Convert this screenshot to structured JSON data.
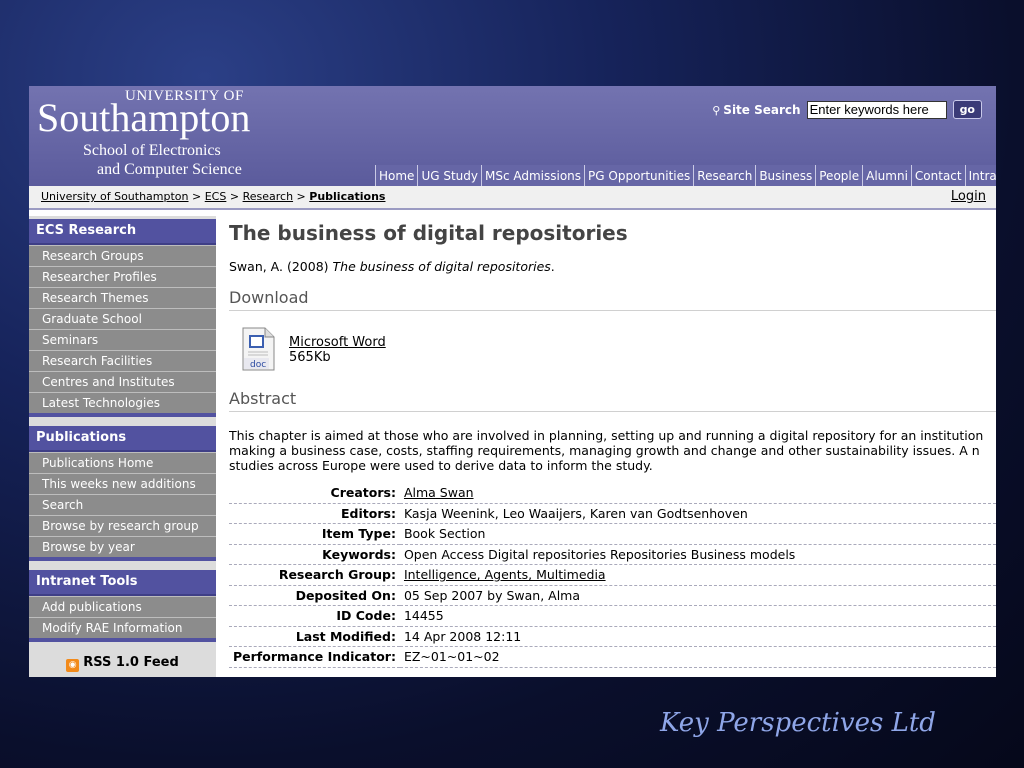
{
  "slide": {
    "footer_title": "Key Perspectives Ltd"
  },
  "header": {
    "logo_top": "UNIVERSITY OF",
    "logo_main": "Southampton",
    "logo_sub1": "School of Electronics",
    "logo_sub2": "and Computer Science",
    "search_label": "Site Search",
    "search_value": "Enter keywords here",
    "search_button": "go",
    "nav": [
      "Home",
      "UG Study",
      "MSc Admissions",
      "PG Opportunities",
      "Research",
      "Business",
      "People",
      "Alumni",
      "Contact",
      "Intranet"
    ]
  },
  "breadcrumb": {
    "items": [
      "University of Southampton",
      "ECS",
      "Research"
    ],
    "separator": ">",
    "current": "Publications",
    "login": "Login"
  },
  "sidebar": {
    "sections": [
      {
        "title": "ECS Research",
        "items": [
          "Research Groups",
          "Researcher Profiles",
          "Research Themes",
          "Graduate School",
          "Seminars",
          "Research Facilities",
          "Centres and Institutes",
          "Latest Technologies"
        ]
      },
      {
        "title": "Publications",
        "items": [
          "Publications Home",
          "This weeks new additions",
          "Search",
          "Browse by research group",
          "Browse by year"
        ]
      },
      {
        "title": "Intranet Tools",
        "items": [
          "Add publications",
          "Modify RAE Information"
        ]
      }
    ],
    "rss": "RSS 1.0 Feed"
  },
  "main": {
    "title": "The business of digital repositories",
    "citation_authors": "Swan, A. (2008)",
    "citation_title": "The business of digital repositories",
    "citation_end": ".",
    "download_heading": "Download",
    "download_icon_label": "doc",
    "download_link": "Microsoft Word",
    "download_size": "565Kb",
    "abstract_heading": "Abstract",
    "abstract_line1": "This chapter is aimed at those who are involved in planning, setting up and running a digital repository for an institution",
    "abstract_line2": "making a business case, costs, staffing requirements, managing growth and change and other sustainability issues. A n",
    "abstract_line3": "studies across Europe were used to derive data to inform the study.",
    "metadata": [
      {
        "label": "Creators:",
        "value": "Alma Swan",
        "link": true
      },
      {
        "label": "Editors:",
        "value": "Kasja Weenink, Leo Waaijers, Karen van Godtsenhoven",
        "link": false
      },
      {
        "label": "Item Type:",
        "value": "Book Section",
        "link": false
      },
      {
        "label": "Keywords:",
        "value": "Open Access Digital repositories Repositories Business models",
        "link": false
      },
      {
        "label": "Research Group:",
        "value": "Intelligence, Agents, Multimedia",
        "link": true
      },
      {
        "label": "Deposited On:",
        "value": "05 Sep 2007 by Swan, Alma",
        "link": false
      },
      {
        "label": "ID Code:",
        "value": "14455",
        "link": false
      },
      {
        "label": "Last Modified:",
        "value": "14 Apr 2008 12:11",
        "link": false
      },
      {
        "label": "Performance Indicator:",
        "value": "EZ~01~01~02",
        "link": false
      }
    ]
  }
}
